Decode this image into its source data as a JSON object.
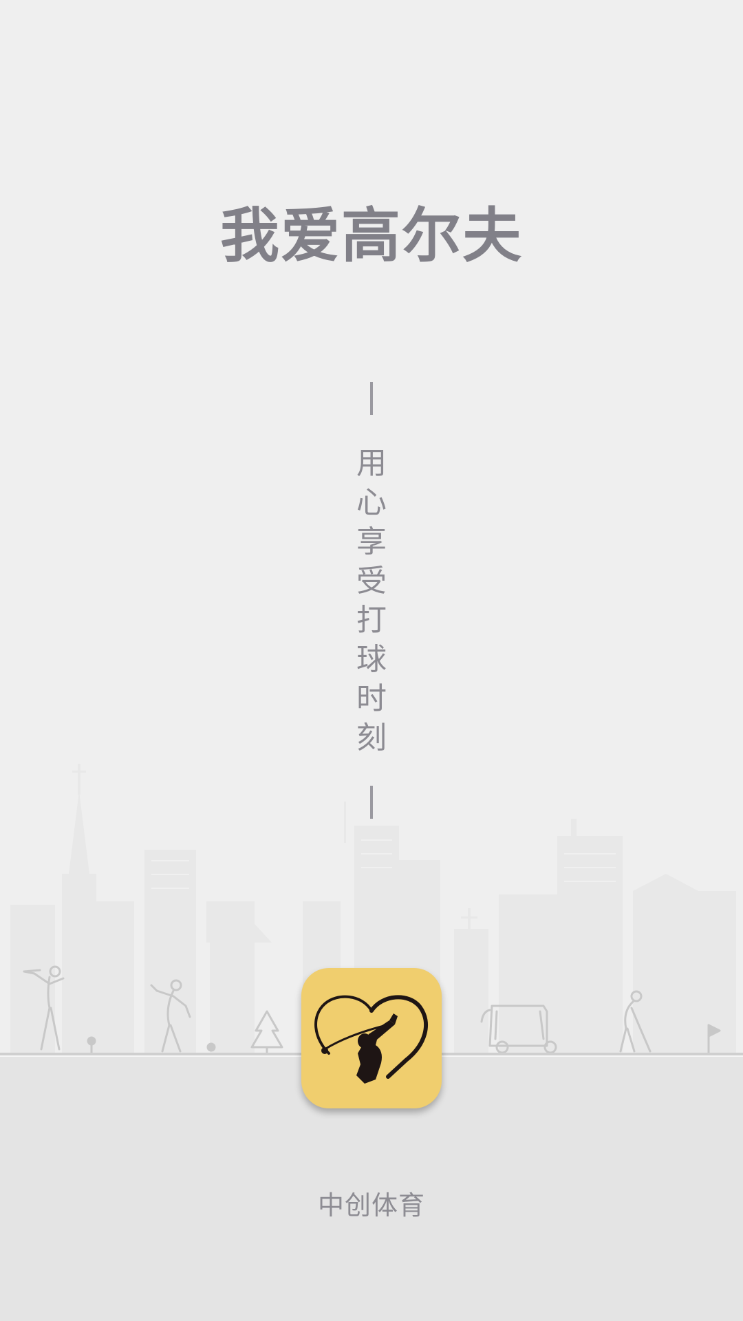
{
  "splash": {
    "title": "我爱高尔夫",
    "slogan_chars": [
      "用",
      "心",
      "享",
      "受",
      "打",
      "球",
      "时",
      "刻"
    ],
    "company": "中创体育"
  },
  "colors": {
    "background": "#efefef",
    "ground": "#e4e4e4",
    "title_text": "#818088",
    "icon_background": "#f0ce6e",
    "icon_figure": "#1e1514"
  },
  "icons": {
    "app_logo": "golfer-heart-icon",
    "decor": [
      "golfer-swing-icon",
      "tee-ball-icon",
      "golfer-follow-through-icon",
      "ball-icon",
      "pine-tree-icon",
      "golf-cart-icon",
      "golfer-putting-icon",
      "flag-icon"
    ]
  }
}
